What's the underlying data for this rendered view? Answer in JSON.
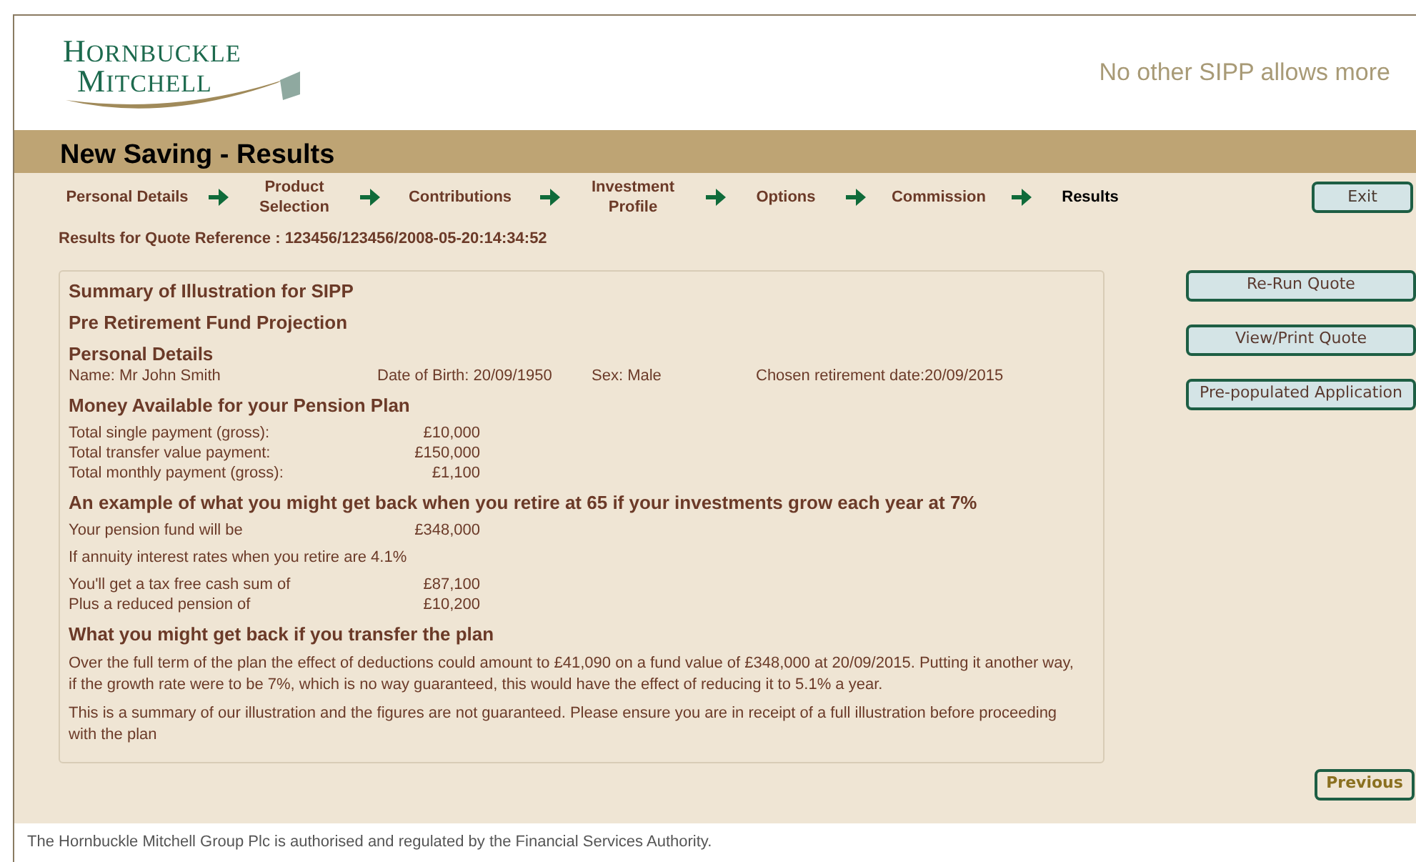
{
  "logo": {
    "line_1": "HORNBUCKLE",
    "line_2": "MITCHELL"
  },
  "tagline": "No other SIPP allows more",
  "page_title": "New Saving - Results",
  "steps": [
    {
      "label": "Personal Details",
      "selected": false
    },
    {
      "label": "Product Selection",
      "selected": false
    },
    {
      "label": "Contributions",
      "selected": false
    },
    {
      "label": "Investment Profile",
      "selected": false
    },
    {
      "label": "Options",
      "selected": false
    },
    {
      "label": "Commission",
      "selected": false
    },
    {
      "label": "Results",
      "selected": true
    }
  ],
  "exit_button": "Exit",
  "quote_reference": "Results for Quote Reference : 123456/123456/2008-05-20:14:34:52",
  "summary": [
    {
      "kind": "heading",
      "text": "Summary of Illustration for SIPP"
    },
    {
      "kind": "heading",
      "text": "Pre Retirement Fund Projection"
    },
    {
      "kind": "heading",
      "text": "Personal Details"
    },
    {
      "kind": "details",
      "items": [
        "Name: Mr John Smith",
        "Date of Birth: 20/09/1950",
        "Sex:  Male",
        "Chosen retirement date:20/09/2015"
      ]
    },
    {
      "kind": "heading",
      "text": "Money Available for your Pension Plan"
    },
    {
      "kind": "amounts",
      "rows": [
        {
          "label": "Total single payment (gross):",
          "value": "£10,000"
        },
        {
          "label": "Total transfer value payment:",
          "value": "£150,000"
        },
        {
          "label": "Total monthly payment (gross):",
          "value": "£1,100"
        }
      ]
    },
    {
      "kind": "heading",
      "text": "An example of what you might get back when you retire at 65 if your investments grow each year at 7%"
    },
    {
      "kind": "amounts",
      "rows": [
        {
          "label": "Your pension fund will be",
          "value": "£348,000"
        }
      ]
    },
    {
      "kind": "paragraph",
      "text": "If annuity interest rates when you retire are 4.1%"
    },
    {
      "kind": "amounts",
      "rows": [
        {
          "label": "You'll get a tax free cash sum of",
          "value": "£87,100"
        },
        {
          "label": "Plus a reduced pension of",
          "value": "£10,200"
        }
      ]
    },
    {
      "kind": "heading",
      "text": "What you might get back if you transfer the plan"
    },
    {
      "kind": "paragraph",
      "text": "Over the full term of the plan the effect of deductions could amount to £41,090 on a fund value of £348,000 at 20/09/2015. Putting it another way, if the growth rate were to be 7%, which is no way guaranteed, this would have the effect of reducing it to 5.1% a year."
    },
    {
      "kind": "paragraph",
      "text": "This is a summary of our illustration and the figures are not guaranteed. Please ensure you are in receipt of a full illustration before proceeding with the plan"
    }
  ],
  "actions": [
    "Re-Run Quote",
    "View/Print Quote",
    "Pre-populated Application"
  ],
  "previous_button": "Previous",
  "footer": "The Hornbuckle Mitchell Group Plc is authorised and regulated by the Financial Services Authority."
}
